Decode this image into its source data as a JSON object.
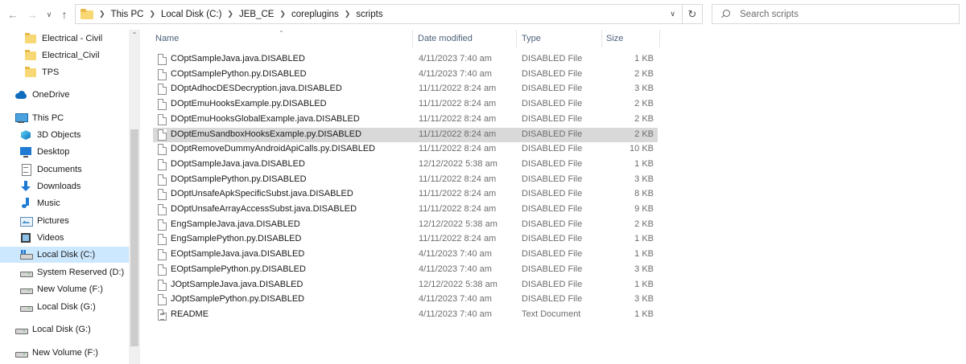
{
  "nav": {
    "breadcrumbs": [
      "This PC",
      "Local Disk (C:)",
      "JEB_CE",
      "coreplugins",
      "scripts"
    ]
  },
  "search": {
    "placeholder": "Search scripts"
  },
  "sidebar": {
    "items": [
      {
        "label": "Electrical - Civil",
        "icon": "folder-icon"
      },
      {
        "label": "Electrical_Civil",
        "icon": "folder-icon"
      },
      {
        "label": "TPS",
        "icon": "folder-icon"
      },
      {
        "label": "OneDrive",
        "icon": "onedrive-icon"
      },
      {
        "label": "This PC",
        "icon": "this-pc-icon"
      },
      {
        "label": "3D Objects",
        "icon": "3d-objects-icon"
      },
      {
        "label": "Desktop",
        "icon": "desktop-icon"
      },
      {
        "label": "Documents",
        "icon": "documents-icon"
      },
      {
        "label": "Downloads",
        "icon": "downloads-icon"
      },
      {
        "label": "Music",
        "icon": "music-icon"
      },
      {
        "label": "Pictures",
        "icon": "pictures-icon"
      },
      {
        "label": "Videos",
        "icon": "videos-icon"
      },
      {
        "label": "Local Disk (C:)",
        "icon": "windows-drive-icon",
        "selected": true
      },
      {
        "label": "System Reserved (D:)",
        "icon": "drive-icon"
      },
      {
        "label": "New Volume (F:)",
        "icon": "drive-icon"
      },
      {
        "label": "Local Disk (G:)",
        "icon": "drive-icon"
      },
      {
        "label": "Local Disk (G:)",
        "icon": "drive-icon"
      },
      {
        "label": "New Volume (F:)",
        "icon": "drive-icon"
      }
    ]
  },
  "columns": {
    "name": "Name",
    "date": "Date modified",
    "type": "Type",
    "size": "Size"
  },
  "files": [
    {
      "name": "COptSampleJava.java.DISABLED",
      "date": "4/11/2023 7:40 am",
      "type": "DISABLED File",
      "size": "1 KB"
    },
    {
      "name": "COptSamplePython.py.DISABLED",
      "date": "4/11/2023 7:40 am",
      "type": "DISABLED File",
      "size": "2 KB"
    },
    {
      "name": "DOptAdhocDESDecryption.java.DISABLED",
      "date": "11/11/2022 8:24 am",
      "type": "DISABLED File",
      "size": "3 KB"
    },
    {
      "name": "DOptEmuHooksExample.py.DISABLED",
      "date": "11/11/2022 8:24 am",
      "type": "DISABLED File",
      "size": "2 KB"
    },
    {
      "name": "DOptEmuHooksGlobalExample.java.DISABLED",
      "date": "11/11/2022 8:24 am",
      "type": "DISABLED File",
      "size": "2 KB"
    },
    {
      "name": "DOptEmuSandboxHooksExample.py.DISABLED",
      "date": "11/11/2022 8:24 am",
      "type": "DISABLED File",
      "size": "2 KB",
      "selected": true
    },
    {
      "name": "DOptRemoveDummyAndroidApiCalls.py.DISABLED",
      "date": "11/11/2022 8:24 am",
      "type": "DISABLED File",
      "size": "10 KB"
    },
    {
      "name": "DOptSampleJava.java.DISABLED",
      "date": "12/12/2022 5:38 am",
      "type": "DISABLED File",
      "size": "1 KB"
    },
    {
      "name": "DOptSamplePython.py.DISABLED",
      "date": "11/11/2022 8:24 am",
      "type": "DISABLED File",
      "size": "3 KB"
    },
    {
      "name": "DOptUnsafeApkSpecificSubst.java.DISABLED",
      "date": "11/11/2022 8:24 am",
      "type": "DISABLED File",
      "size": "8 KB"
    },
    {
      "name": "DOptUnsafeArrayAccessSubst.java.DISABLED",
      "date": "11/11/2022 8:24 am",
      "type": "DISABLED File",
      "size": "9 KB"
    },
    {
      "name": "EngSampleJava.java.DISABLED",
      "date": "12/12/2022 5:38 am",
      "type": "DISABLED File",
      "size": "2 KB"
    },
    {
      "name": "EngSamplePython.py.DISABLED",
      "date": "11/11/2022 8:24 am",
      "type": "DISABLED File",
      "size": "1 KB"
    },
    {
      "name": "EOptSampleJava.java.DISABLED",
      "date": "4/11/2023 7:40 am",
      "type": "DISABLED File",
      "size": "1 KB"
    },
    {
      "name": "EOptSamplePython.py.DISABLED",
      "date": "4/11/2023 7:40 am",
      "type": "DISABLED File",
      "size": "3 KB"
    },
    {
      "name": "JOptSampleJava.java.DISABLED",
      "date": "12/12/2022 5:38 am",
      "type": "DISABLED File",
      "size": "1 KB"
    },
    {
      "name": "JOptSamplePython.py.DISABLED",
      "date": "4/11/2023 7:40 am",
      "type": "DISABLED File",
      "size": "3 KB"
    },
    {
      "name": "README",
      "date": "4/11/2023 7:40 am",
      "type": "Text Document",
      "size": "1 KB"
    }
  ],
  "colors": {
    "selected_nav": "#cce8ff",
    "selected_row": "#d9d9d9",
    "header_text": "#4c607a"
  }
}
